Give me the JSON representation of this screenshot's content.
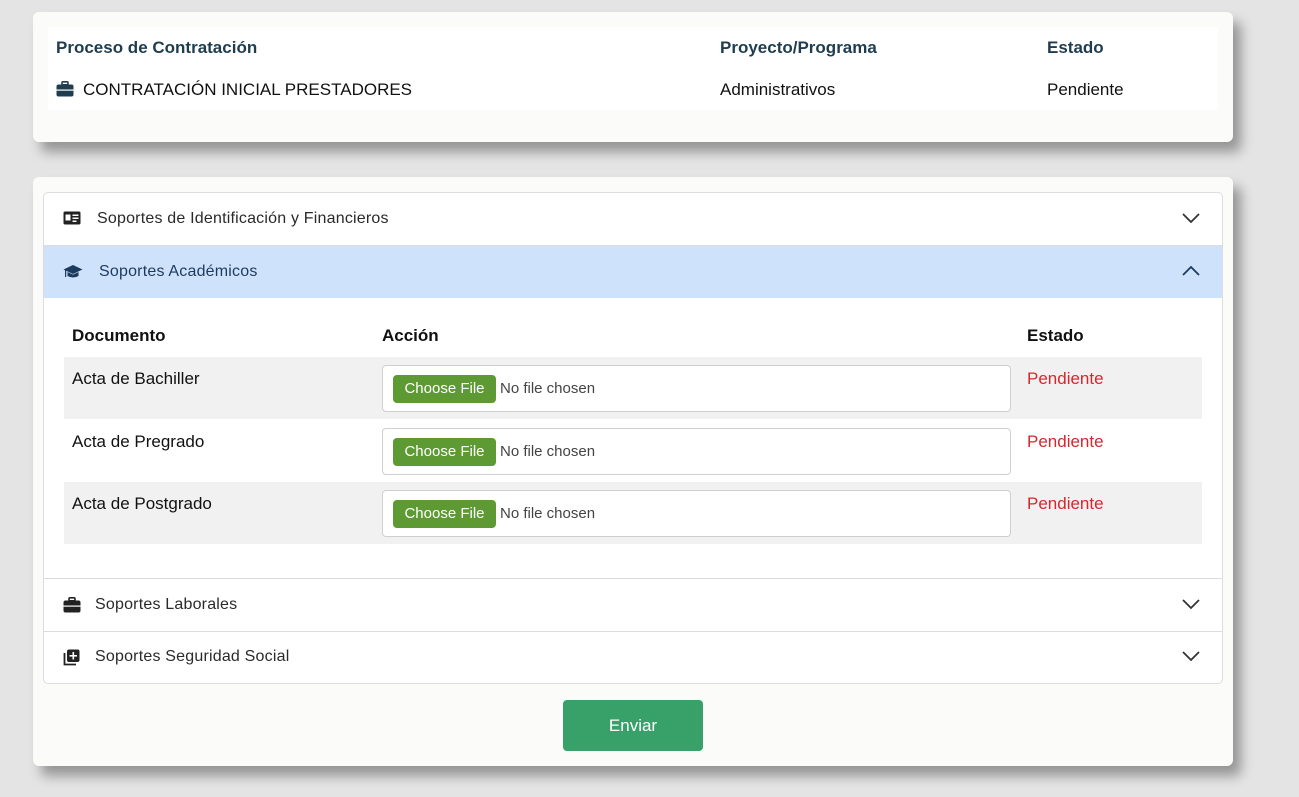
{
  "process_table": {
    "headers": [
      "Proceso de Contratación",
      "Proyecto/Programa",
      "Estado"
    ],
    "row": {
      "proceso": "CONTRATACIÓN INICIAL PRESTADORES",
      "proyecto": "Administrativos",
      "estado": "Pendiente",
      "icon": "briefcase-icon"
    }
  },
  "accordion": {
    "sections": [
      {
        "label": "Soportes de Identificación y Financieros",
        "icon": "id-card-icon",
        "expanded": false
      },
      {
        "label": "Soportes Académicos",
        "icon": "graduation-cap-icon",
        "expanded": true
      },
      {
        "label": "Soportes Laborales",
        "icon": "briefcase-icon",
        "expanded": false
      },
      {
        "label": "Soportes Seguridad Social",
        "icon": "medical-plus-icon",
        "expanded": false
      }
    ],
    "academic_table": {
      "headers": [
        "Documento",
        "Acción",
        "Estado"
      ],
      "rows": [
        {
          "documento": "Acta de Bachiller",
          "button": "Choose File",
          "file_text": "No file chosen",
          "estado": "Pendiente"
        },
        {
          "documento": "Acta de Pregrado",
          "button": "Choose File",
          "file_text": "No file chosen",
          "estado": "Pendiente"
        },
        {
          "documento": "Acta de Postgrado",
          "button": "Choose File",
          "file_text": "No file chosen",
          "estado": "Pendiente"
        }
      ]
    }
  },
  "submit_label": "Enviar",
  "colors": {
    "background": "#e4e4e4",
    "header_text": "#1f3d4f",
    "active_section": "#cfe2fb",
    "file_button": "#5d9a33",
    "status_pending": "#d7262e",
    "submit": "#38a169"
  }
}
